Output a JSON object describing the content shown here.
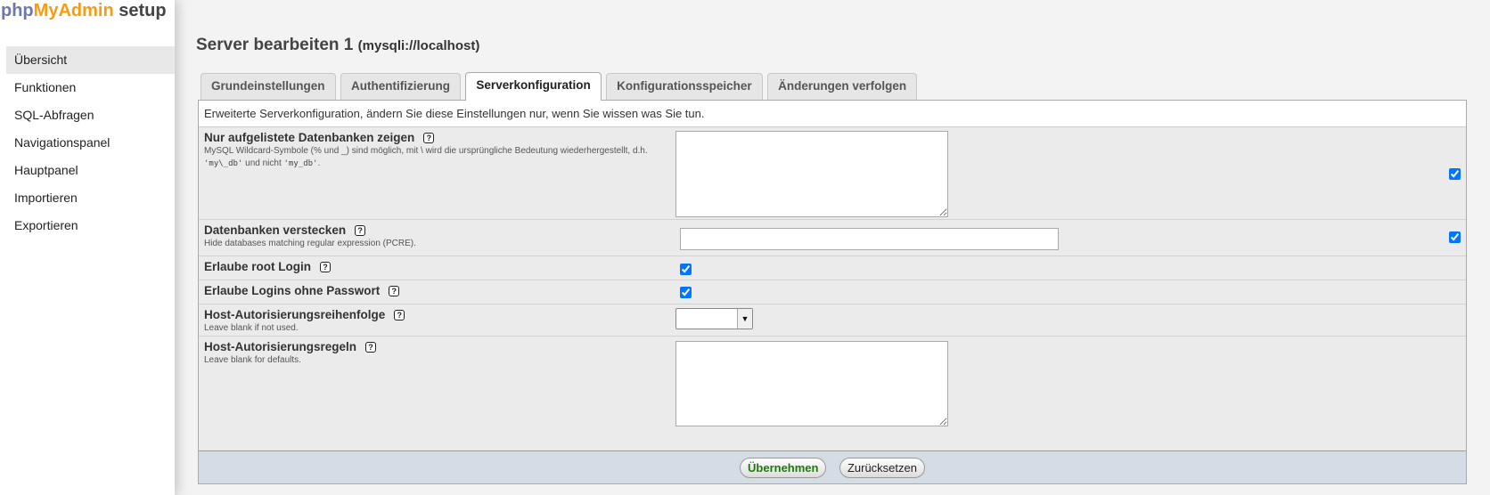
{
  "logo": {
    "part1": "php",
    "part2": "MyAdmin",
    "part3": " setup"
  },
  "sidebar": {
    "items": [
      {
        "label": "Übersicht"
      },
      {
        "label": "Funktionen"
      },
      {
        "label": "SQL-Abfragen"
      },
      {
        "label": "Navigationspanel"
      },
      {
        "label": "Hauptpanel"
      },
      {
        "label": "Importieren"
      },
      {
        "label": "Exportieren"
      }
    ]
  },
  "page": {
    "title": "Server bearbeiten 1",
    "subtitle": "(mysqli://localhost)"
  },
  "tabs": [
    {
      "label": "Grundeinstellungen"
    },
    {
      "label": "Authentifizierung"
    },
    {
      "label": "Serverkonfiguration"
    },
    {
      "label": "Konfigurationsspeicher"
    },
    {
      "label": "Änderungen verfolgen"
    }
  ],
  "panel": {
    "description": "Erweiterte Serverkonfiguration, ändern Sie diese Einstellungen nur, wenn Sie wissen was Sie tun.",
    "help_glyph": "?",
    "fields": {
      "only_db": {
        "label": "Nur aufgelistete Datenbanken zeigen",
        "desc_text": "MySQL Wildcard-Symbole (% und _) sind möglich, mit \\ wird die ursprüngliche Bedeutung wiederhergestellt, d.h.",
        "code1": "'my\\_db'",
        "desc_mid": " und nicht ",
        "code2": "'my_db'",
        "desc_end": ".",
        "value": ""
      },
      "hide_db": {
        "label": "Datenbanken verstecken",
        "desc": "Hide databases matching regular expression (PCRE).",
        "value": ""
      },
      "allow_root": {
        "label": "Erlaube root Login"
      },
      "allow_nopass": {
        "label": "Erlaube Logins ohne Passwort"
      },
      "host_order": {
        "label": "Host-Autorisierungsreihenfolge",
        "desc": "Leave blank if not used.",
        "value": ""
      },
      "host_rules": {
        "label": "Host-Autorisierungsregeln",
        "desc": "Leave blank for defaults.",
        "value": ""
      }
    }
  },
  "footer": {
    "apply": "Übernehmen",
    "reset": "Zurücksetzen"
  }
}
